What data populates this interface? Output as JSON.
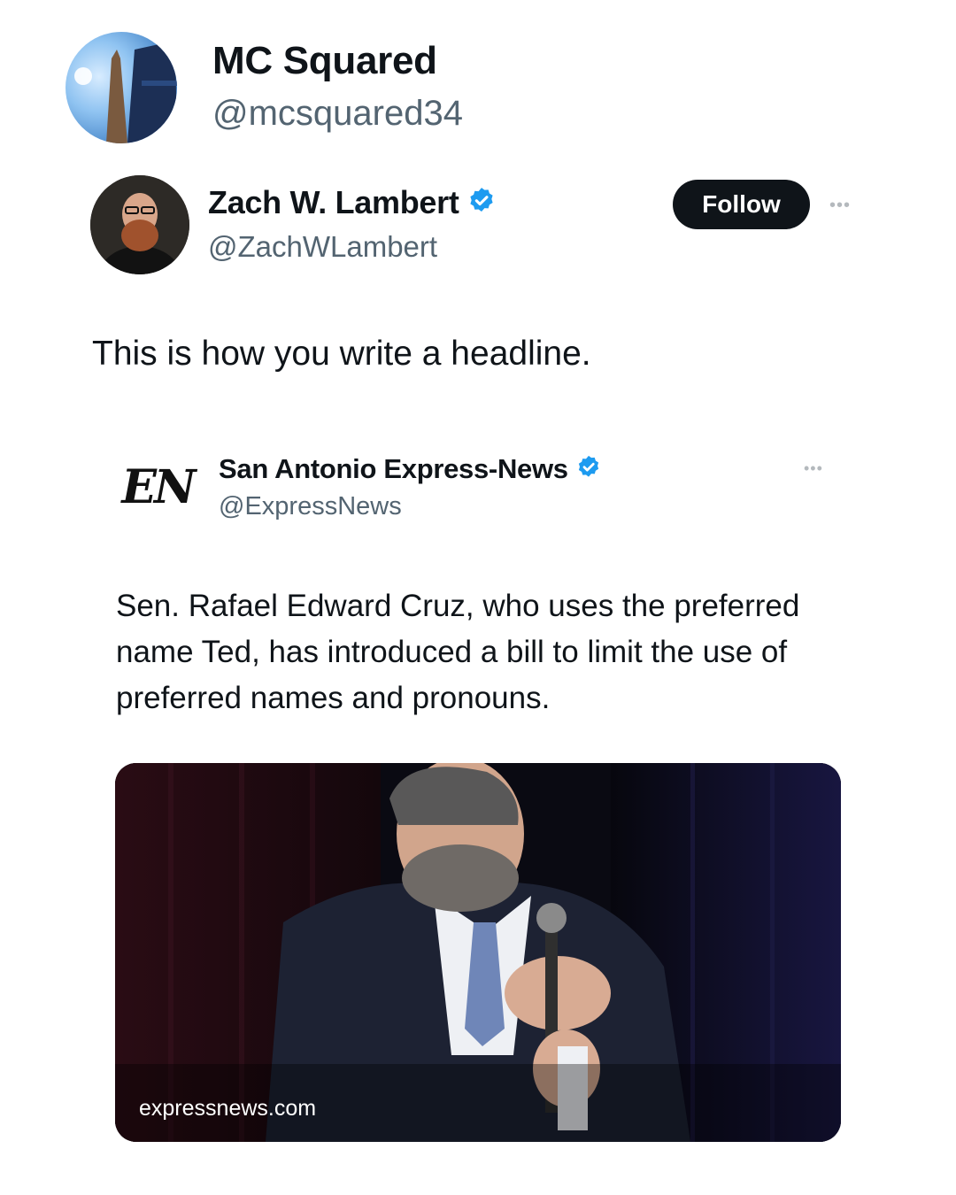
{
  "poster": {
    "name": "MC Squared",
    "handle": "@mcsquared34",
    "avatar_icon": "avatar-photo"
  },
  "tweet": {
    "author_name": "Zach W. Lambert",
    "author_handle": "@ZachWLambert",
    "verified": true,
    "follow_label": "Follow",
    "more_icon": "more-icon",
    "text": "This is how you write a headline."
  },
  "quoted_tweet": {
    "logo_text": "EN",
    "author_name": "San Antonio Express-News",
    "author_handle": "@ExpressNews",
    "verified": true,
    "more_icon": "more-icon",
    "text": "Sen. Rafael Edward Cruz, who uses the preferred name Ted, has introduced a bill to limit the use of preferred names and pronouns.",
    "image": {
      "source_label": "expressnews.com"
    }
  },
  "colors": {
    "verified_blue": "#1d9bf0",
    "text_primary": "#0f1419",
    "text_secondary": "#536471",
    "follow_bg": "#0f1419"
  }
}
